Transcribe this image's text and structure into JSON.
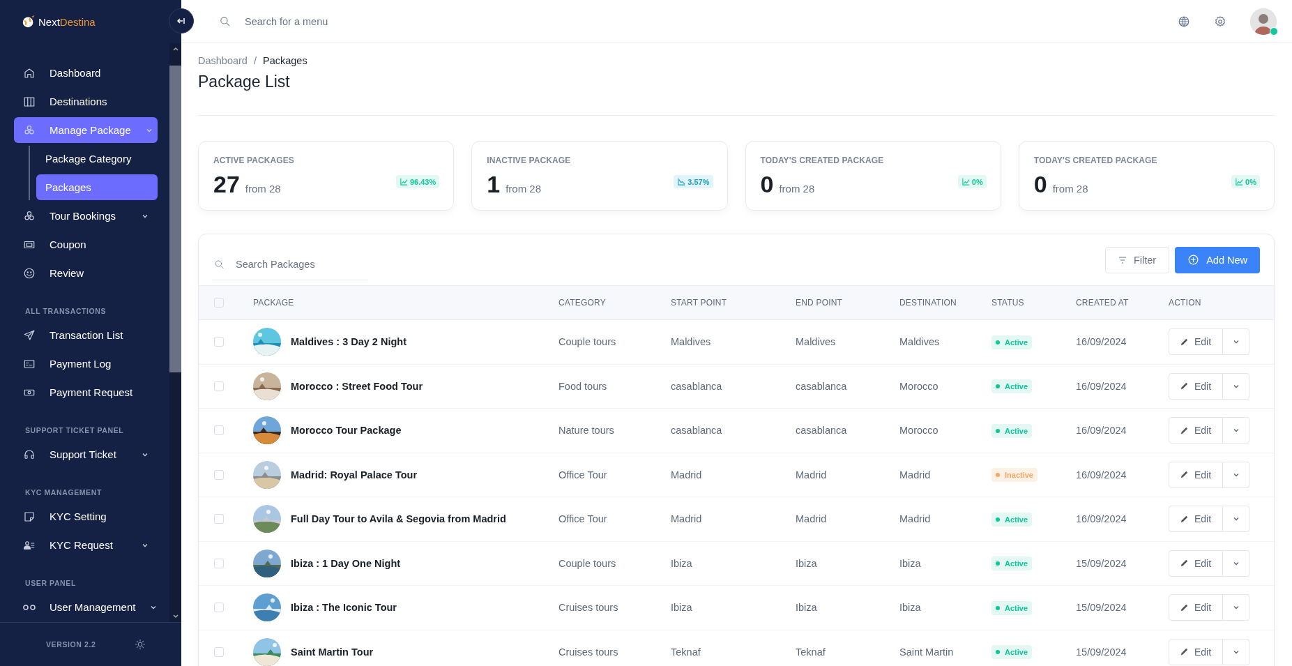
{
  "brand": {
    "part_1": "Next",
    "part_2": "Destina"
  },
  "sidebar": {
    "sections": [
      {
        "items": [
          {
            "label": "Dashboard",
            "kind": "link",
            "selected": false
          },
          {
            "label": "Destinations",
            "kind": "link",
            "selected": false
          },
          {
            "label": "Manage Package",
            "kind": "group",
            "selected": true,
            "children": [
              {
                "label": "Package Category",
                "selected": false
              },
              {
                "label": "Packages",
                "selected": true
              }
            ]
          },
          {
            "label": "Tour Bookings",
            "kind": "group",
            "selected": false
          },
          {
            "label": "Coupon",
            "kind": "link",
            "selected": false
          },
          {
            "label": "Review",
            "kind": "link",
            "selected": false
          }
        ]
      },
      {
        "title": "ALL TRANSACTIONS",
        "items": [
          {
            "label": "Transaction List",
            "kind": "link",
            "selected": false
          },
          {
            "label": "Payment Log",
            "kind": "link",
            "selected": false
          },
          {
            "label": "Payment Request",
            "kind": "link",
            "selected": false
          }
        ]
      },
      {
        "title": "SUPPORT TICKET PANEL",
        "items": [
          {
            "label": "Support Ticket",
            "kind": "group",
            "selected": false
          }
        ]
      },
      {
        "title": "KYC MANAGEMENT",
        "items": [
          {
            "label": "KYC Setting",
            "kind": "link",
            "selected": false
          },
          {
            "label": "KYC Request",
            "kind": "group",
            "selected": false
          }
        ]
      },
      {
        "title": "USER PANEL",
        "items": [
          {
            "label": "User Management",
            "kind": "group",
            "selected": false
          }
        ]
      }
    ],
    "version": "VERSION 2.2"
  },
  "topbar": {
    "search_placeholder": "Search for a menu",
    "avatar": {
      "online": true
    }
  },
  "breadcrumb": [
    "Dashboard",
    "/",
    "Packages"
  ],
  "page_title": "Package List",
  "stats": [
    {
      "title": "ACTIVE PACKAGES",
      "value": "27",
      "from": "from 28",
      "change": "96.43%",
      "kind": "up"
    },
    {
      "title": "INACTIVE PACKAGE",
      "value": "1",
      "from": "from 28",
      "change": "3.57%",
      "kind": "down"
    },
    {
      "title": "TODAY'S CREATED PACKAGE",
      "value": "0",
      "from": "from 28",
      "change": "0%",
      "kind": "up"
    },
    {
      "title": "TODAY'S CREATED PACKAGE",
      "value": "0",
      "from": "from 28",
      "change": "0%",
      "kind": "up"
    }
  ],
  "table": {
    "search_placeholder": "Search Packages",
    "filter_button": "Filter",
    "add_button": "Add New",
    "select_all": {
      "checked": false
    },
    "columns": [
      "PACKAGE",
      "CATEGORY",
      "START POINT",
      "END POINT",
      "DESTINATION",
      "STATUS",
      "CREATED AT",
      "ACTION"
    ],
    "rows": [
      {
        "checked": false,
        "package": "Maldives : 3 Day 2 Night",
        "category": "Couple tours",
        "start": "Maldives",
        "end": "Maldives",
        "destination": "Maldives",
        "status": "Active",
        "kind": "active",
        "created": "16/09/2024",
        "action": "Edit"
      },
      {
        "checked": false,
        "package": "Morocco : Street Food Tour",
        "category": "Food tours",
        "start": "casablanca",
        "end": "casablanca",
        "destination": "Morocco",
        "status": "Active",
        "kind": "active",
        "created": "16/09/2024",
        "action": "Edit"
      },
      {
        "checked": false,
        "package": "Morocco Tour Package",
        "category": "Nature tours",
        "start": "casablanca",
        "end": "casablanca",
        "destination": "Morocco",
        "status": "Active",
        "kind": "active",
        "created": "16/09/2024",
        "action": "Edit"
      },
      {
        "checked": false,
        "package": "Madrid: Royal Palace Tour",
        "category": "Office Tour",
        "start": "Madrid",
        "end": "Madrid",
        "destination": "Madrid",
        "status": "Inactive",
        "kind": "inactive",
        "created": "16/09/2024",
        "action": "Edit"
      },
      {
        "checked": false,
        "package": "Full Day Tour to Avila & Segovia from Madrid",
        "category": "Office Tour",
        "start": "Madrid",
        "end": "Madrid",
        "destination": "Madrid",
        "status": "Active",
        "kind": "active",
        "created": "16/09/2024",
        "action": "Edit"
      },
      {
        "checked": false,
        "package": "Ibiza : 1 Day One Night",
        "category": "Couple tours",
        "start": "Ibiza",
        "end": "Ibiza",
        "destination": "Ibiza",
        "status": "Active",
        "kind": "active",
        "created": "15/09/2024",
        "action": "Edit"
      },
      {
        "checked": false,
        "package": "Ibiza : The Iconic Tour",
        "category": "Cruises tours",
        "start": "Ibiza",
        "end": "Ibiza",
        "destination": "Ibiza",
        "status": "Active",
        "kind": "active",
        "created": "15/09/2024",
        "action": "Edit"
      },
      {
        "checked": false,
        "package": "Saint Martin Tour",
        "category": "Cruises tours",
        "start": "Teknaf",
        "end": "Teknaf",
        "destination": "Saint Martin",
        "status": "Active",
        "kind": "active",
        "created": "15/09/2024",
        "action": "Edit"
      }
    ]
  }
}
